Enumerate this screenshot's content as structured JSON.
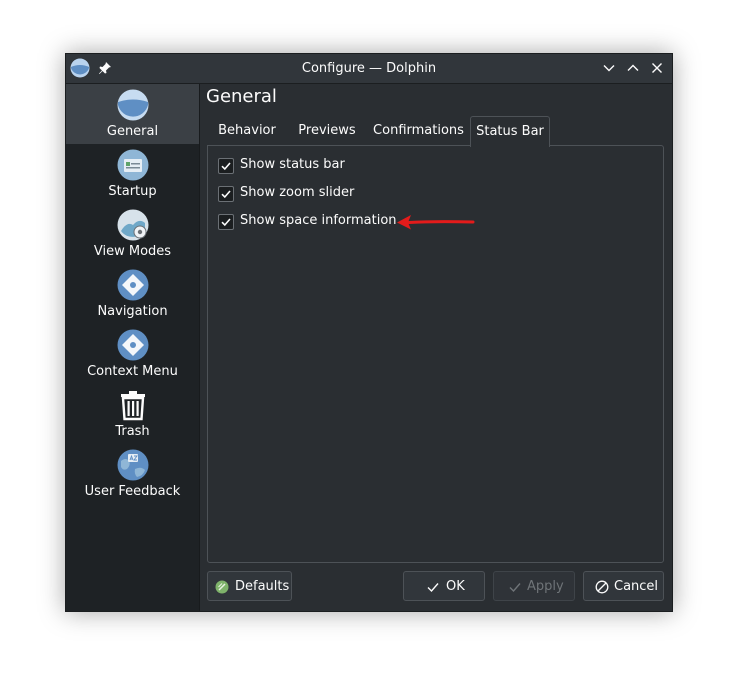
{
  "window": {
    "title": "Configure — Dolphin"
  },
  "sidebar": {
    "items": [
      {
        "label": "General",
        "icon": "folder-icon",
        "selected": true
      },
      {
        "label": "Startup",
        "icon": "startup-icon"
      },
      {
        "label": "View Modes",
        "icon": "view-modes-icon"
      },
      {
        "label": "Navigation",
        "icon": "navigation-icon"
      },
      {
        "label": "Context Menu",
        "icon": "context-menu-icon"
      },
      {
        "label": "Trash",
        "icon": "trash-icon"
      },
      {
        "label": "User Feedback",
        "icon": "user-feedback-icon"
      }
    ]
  },
  "main": {
    "title": "General",
    "tabs": [
      {
        "label": "Behavior"
      },
      {
        "label": "Previews"
      },
      {
        "label": "Confirmations"
      },
      {
        "label": "Status Bar",
        "active": true
      }
    ],
    "options": [
      {
        "label": "Show status bar",
        "checked": true
      },
      {
        "label": "Show zoom slider",
        "checked": true
      },
      {
        "label": "Show space information",
        "checked": true
      }
    ]
  },
  "buttons": {
    "defaults": "Defaults",
    "ok": "OK",
    "apply": "Apply",
    "cancel": "Cancel"
  },
  "colors": {
    "background": "#2a2e32",
    "sidebar": "#1e2225",
    "selected": "#3b4045",
    "accent_arrow": "#e31b1b",
    "icon_blue": "#5f8fc4"
  }
}
